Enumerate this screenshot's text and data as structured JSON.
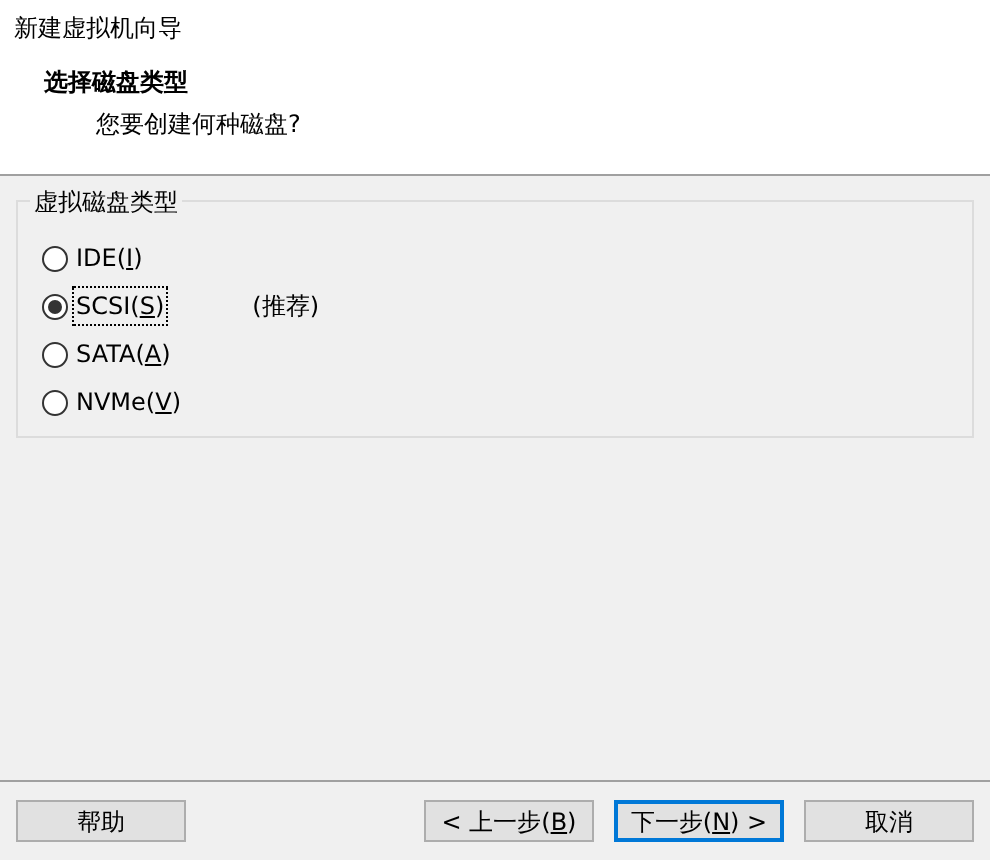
{
  "window": {
    "title": "新建虚拟机向导"
  },
  "header": {
    "title": "选择磁盘类型",
    "subtitle": "您要创建何种磁盘?"
  },
  "group": {
    "title": "虚拟磁盘类型",
    "options": [
      {
        "before": "IDE(",
        "mnemonic": "I",
        "after": ")",
        "selected": false
      },
      {
        "before": "SCSI(",
        "mnemonic": "S",
        "after": ")",
        "note": "(推荐)",
        "selected": true,
        "focused": true
      },
      {
        "before": "SATA(",
        "mnemonic": "A",
        "after": ")",
        "selected": false
      },
      {
        "before": "NVMe(",
        "mnemonic": "V",
        "after": ")",
        "selected": false
      }
    ]
  },
  "buttons": [
    {
      "kind": "left",
      "before": "帮助",
      "default": false
    },
    {
      "kind": "right",
      "before": "< 上一步(",
      "mnemonic": "B",
      "after": ")",
      "default": false
    },
    {
      "kind": "right",
      "before": "下一步(",
      "mnemonic": "N",
      "after": ") >",
      "default": true
    },
    {
      "kind": "right",
      "before": "取消",
      "default": false
    }
  ]
}
